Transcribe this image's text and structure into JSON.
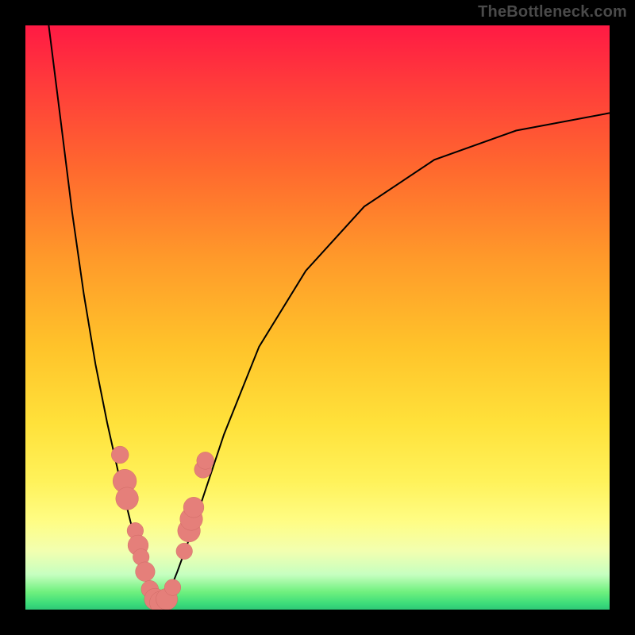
{
  "watermark": "TheBottleneck.com",
  "colors": {
    "background": "#000000",
    "curve": "#000000",
    "dot_fill": "#e57f7a",
    "dot_stroke": "#c96560"
  },
  "chart_data": {
    "type": "line",
    "title": "",
    "xlabel": "",
    "ylabel": "",
    "xlim": [
      0,
      100
    ],
    "ylim": [
      0,
      100
    ],
    "notes": "Black V-shaped curve representing bottleneck percentage; minimum near x≈23. Red→green vertical gradient encodes bottleneck severity (red=high, green=low). Salmon markers are sample points clustered near the curve's minimum on both branches.",
    "series": [
      {
        "name": "bottleneck_curve",
        "x": [
          4,
          6,
          8,
          10,
          12,
          14,
          16,
          18,
          20,
          21,
          22,
          23,
          24,
          25,
          26,
          28,
          30,
          34,
          40,
          48,
          58,
          70,
          84,
          100
        ],
        "y": [
          100,
          84,
          68,
          54,
          42,
          32,
          23,
          15,
          8,
          5,
          2.5,
          1,
          2,
          4,
          6.5,
          12,
          18,
          30,
          45,
          58,
          69,
          77,
          82,
          85
        ]
      }
    ],
    "markers": [
      {
        "x": 16.2,
        "y": 26.5,
        "r": 1.2
      },
      {
        "x": 17.0,
        "y": 22.0,
        "r": 1.8
      },
      {
        "x": 17.4,
        "y": 19.0,
        "r": 1.7
      },
      {
        "x": 18.8,
        "y": 13.5,
        "r": 1.1
      },
      {
        "x": 19.3,
        "y": 11.0,
        "r": 1.5
      },
      {
        "x": 19.8,
        "y": 9.0,
        "r": 1.1
      },
      {
        "x": 20.5,
        "y": 6.5,
        "r": 1.4
      },
      {
        "x": 21.3,
        "y": 3.5,
        "r": 1.2
      },
      {
        "x": 22.2,
        "y": 1.8,
        "r": 1.6
      },
      {
        "x": 23.2,
        "y": 1.2,
        "r": 1.7
      },
      {
        "x": 24.2,
        "y": 1.8,
        "r": 1.6
      },
      {
        "x": 25.2,
        "y": 3.8,
        "r": 1.1
      },
      {
        "x": 27.2,
        "y": 10.0,
        "r": 1.1
      },
      {
        "x": 28.0,
        "y": 13.5,
        "r": 1.7
      },
      {
        "x": 28.4,
        "y": 15.5,
        "r": 1.7
      },
      {
        "x": 28.8,
        "y": 17.5,
        "r": 1.5
      },
      {
        "x": 30.4,
        "y": 24.0,
        "r": 1.2
      },
      {
        "x": 30.8,
        "y": 25.5,
        "r": 1.2
      }
    ]
  }
}
